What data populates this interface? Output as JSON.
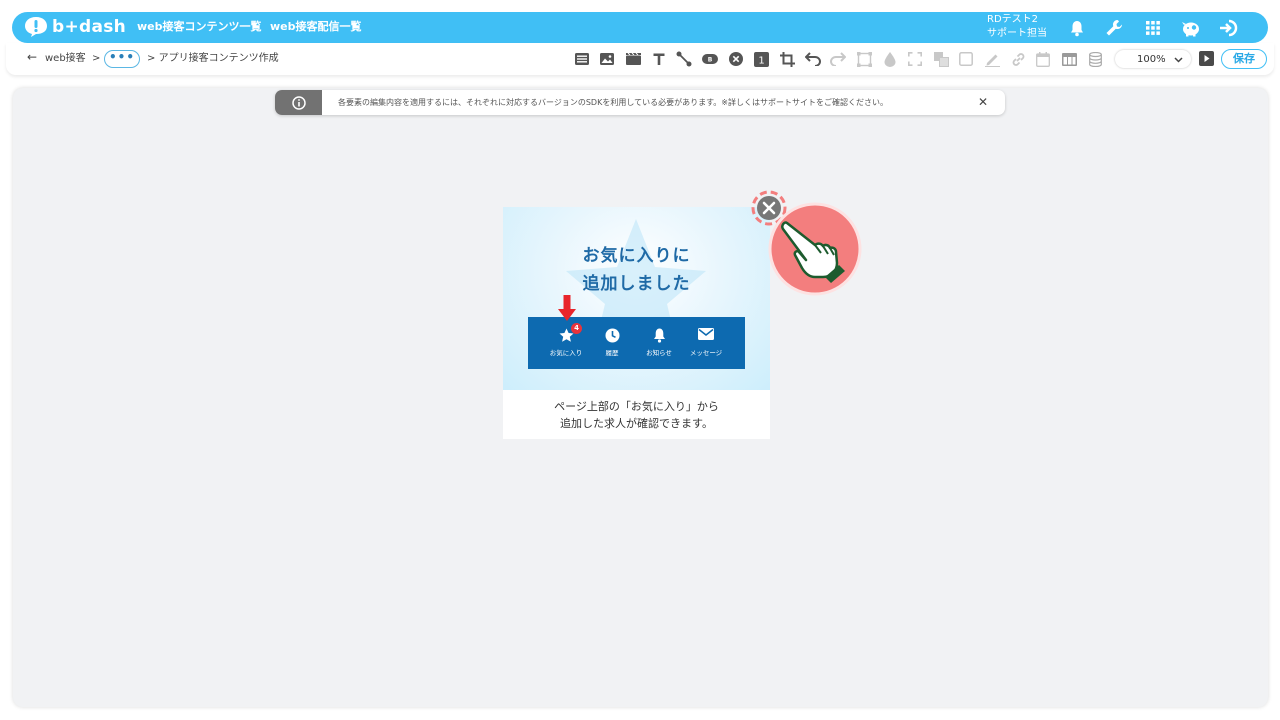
{
  "header": {
    "logo_text": "b+dash",
    "nav": [
      "web接客コンテンツ一覧",
      "web接客配信一覧"
    ],
    "user": {
      "line1": "RDテスト2",
      "line2": "サポート担当"
    },
    "icons": [
      "bell-icon",
      "wrench-icon",
      "apps-grid-icon",
      "piggy-bank-icon",
      "logout-icon"
    ]
  },
  "breadcrumb": {
    "back": "←",
    "root": "web接客",
    "sep": ">",
    "more": "•••",
    "sep2": ">",
    "current": "アプリ接客コンテンツ作成"
  },
  "toolbar": {
    "zoom_value": "100%",
    "save_label": "保存"
  },
  "notice": {
    "text": "各要素の編集内容を適用するには、それぞれに対応するバージョンのSDKを利用している必要があります。※詳しくはサポートサイトをご確認ください。",
    "close": "✕"
  },
  "popup": {
    "headline_line1": "お気に入りに",
    "headline_line2": "追加しました",
    "tabs": [
      {
        "label": "お気に入り",
        "badge": "4"
      },
      {
        "label": "履歴"
      },
      {
        "label": "お知らせ"
      },
      {
        "label": "メッセージ"
      }
    ],
    "body_line1": "ページ上部の「お気に入り」から",
    "body_line2": "追加した求人が確認できます。"
  },
  "colors": {
    "header_bg": "#40bff5",
    "tabbar_bg": "#0d6ab0",
    "headline": "#1f6aa6",
    "canvas_bg": "#f1f2f4",
    "hand_circle": "#f37e7e"
  }
}
